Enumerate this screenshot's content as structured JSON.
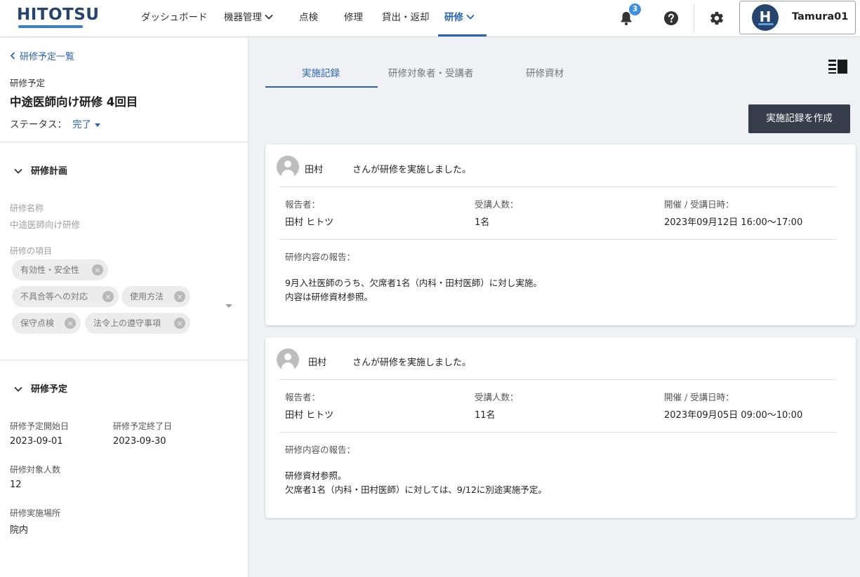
{
  "header": {
    "logo": "HITOTSU",
    "nav": [
      {
        "label": "ダッシュボード",
        "dropdown": false,
        "active": false
      },
      {
        "label": "機器管理",
        "dropdown": true,
        "active": false
      },
      {
        "label": "点検",
        "dropdown": false,
        "active": false
      },
      {
        "label": "修理",
        "dropdown": false,
        "active": false
      },
      {
        "label": "貸出・返却",
        "dropdown": false,
        "active": false
      },
      {
        "label": "研修",
        "dropdown": true,
        "active": true
      }
    ],
    "notifications_count": "3",
    "user": {
      "initial": "H",
      "name": "Tamura01"
    }
  },
  "left": {
    "back_label": "研修予定一覧",
    "schedule_label": "研修予定",
    "title": "中途医師向け研修 4回目",
    "status_label": "ステータス：",
    "status_value": "完了",
    "plan_section": {
      "title": "研修計画",
      "name_label": "研修名称",
      "name_value": "中途医師向け研修",
      "items_label": "研修の項目",
      "chips": [
        "有効性・安全性",
        "不具合等への対応",
        "使用方法",
        "保守点検",
        "法令上の遵守事項"
      ]
    },
    "schedule_section": {
      "title": "研修予定",
      "start_label": "研修予定開始日",
      "start_value": "2023-09-01",
      "end_label": "研修予定終了日",
      "end_value": "2023-09-30",
      "count_label": "研修対象人数",
      "count_value": "12",
      "place_label": "研修実施場所",
      "place_value": "院内"
    }
  },
  "tabs": [
    "実施記録",
    "研修対象者・受講者",
    "研修資材"
  ],
  "active_tab": "実施記録",
  "create_button": "実施記録を作成",
  "records": [
    {
      "name": "田村",
      "message": "さんが研修を実施しました。",
      "reporter_label": "報告者：",
      "reporter": "田村 ヒトツ",
      "attendees_label": "受講人数：",
      "attendees": "1名",
      "datetime_label": "開催 / 受講日時：",
      "datetime": "2023年09月12日 16:00～17:00",
      "report_label": "研修内容の報告：",
      "report_lines": [
        "9月入社医師のうち、欠席者1名（内科・田村医師）に対し実施。",
        "内容は研修資材参照。"
      ]
    },
    {
      "name": "田村",
      "message": "さんが研修を実施しました。",
      "reporter_label": "報告者：",
      "reporter": "田村 ヒトツ",
      "attendees_label": "受講人数：",
      "attendees": "11名",
      "datetime_label": "開催 / 受講日時：",
      "datetime": "2023年09月05日 09:00～10:00",
      "report_label": "研修内容の報告：",
      "report_lines": [
        "研修資材参照。",
        "欠席者1名（内科・田村医師）に対しては、9/12に別途実施予定。"
      ]
    }
  ],
  "colors": {
    "accent": "#2a63b3",
    "brand": "#25456e",
    "button_dark": "#353e4a",
    "badge": "#3d8fe0"
  }
}
